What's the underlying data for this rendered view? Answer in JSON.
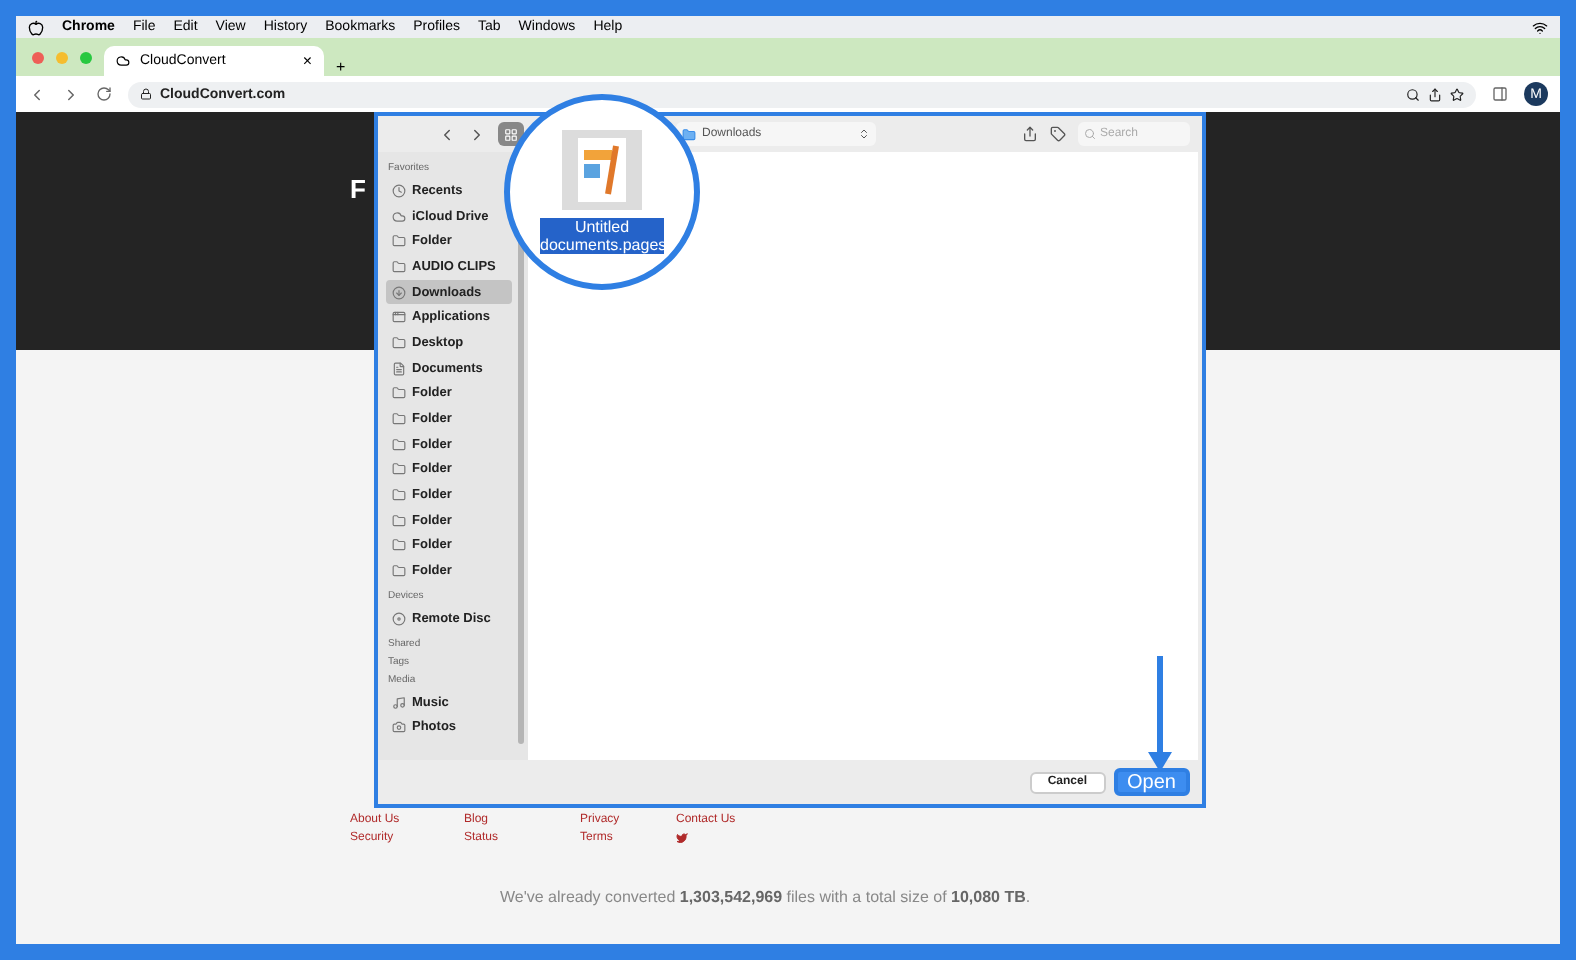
{
  "menu_bar": {
    "app": "Chrome",
    "items": [
      "File",
      "Edit",
      "View",
      "History",
      "Bookmarks",
      "Profiles",
      "Tab",
      "Windows",
      "Help"
    ]
  },
  "browser": {
    "tab": {
      "title": "CloudConvert",
      "close": "×"
    },
    "new_tab": "+",
    "url": "CloudConvert.com",
    "avatar": "M"
  },
  "page": {
    "heading": "F",
    "footer_links": [
      [
        "About Us",
        "Blog",
        "Privacy",
        "Contact Us"
      ],
      [
        "Security",
        "Status",
        "Terms"
      ]
    ],
    "stats": "We've already converted **1,303,542,969** files with a total size of **10,080 TB**."
  },
  "dialog": {
    "location": "Downloads",
    "search": {
      "placeholder": "Search"
    },
    "sidebar": [
      {
        "heading": "Favorites",
        "items": [
          {
            "label": "Recents",
            "kind": "clock",
            "selected": false
          },
          {
            "label": "iCloud Drive",
            "kind": "cloud",
            "selected": false
          },
          {
            "label": "Folder",
            "kind": "folder",
            "selected": false
          },
          {
            "label": "AUDIO CLIPS",
            "kind": "folder",
            "selected": false
          },
          {
            "label": "Downloads",
            "kind": "download",
            "selected": true
          },
          {
            "label": "Applications",
            "kind": "apps",
            "selected": false
          },
          {
            "label": "Desktop",
            "kind": "folder",
            "selected": false
          },
          {
            "label": "Documents",
            "kind": "doc",
            "selected": false
          },
          {
            "label": "Folder",
            "kind": "folder",
            "selected": false
          },
          {
            "label": "Folder",
            "kind": "folder",
            "selected": false
          },
          {
            "label": "Folder",
            "kind": "folder",
            "selected": false
          },
          {
            "label": "Folder",
            "kind": "folder",
            "selected": false
          },
          {
            "label": "Folder",
            "kind": "folder",
            "selected": false
          },
          {
            "label": "Folder",
            "kind": "folder",
            "selected": false
          },
          {
            "label": "Folder",
            "kind": "folder",
            "selected": false
          },
          {
            "label": "Folder",
            "kind": "folder",
            "selected": false
          }
        ]
      },
      {
        "heading": "Devices",
        "items": [
          {
            "label": "Remote Disc",
            "kind": "disc",
            "selected": false
          }
        ]
      },
      {
        "heading": "Shared"
      },
      {
        "heading": "Tags"
      },
      {
        "heading": "Media",
        "items": [
          {
            "label": "Music",
            "kind": "music",
            "selected": false
          },
          {
            "label": "Photos",
            "kind": "camera",
            "selected": false
          }
        ]
      }
    ],
    "file": {
      "name": "Untitled documents.pages",
      "selected": true
    },
    "buttons": [
      {
        "label": "Cancel",
        "kind": "secondary"
      },
      {
        "label": "Open",
        "kind": "primary"
      }
    ]
  }
}
